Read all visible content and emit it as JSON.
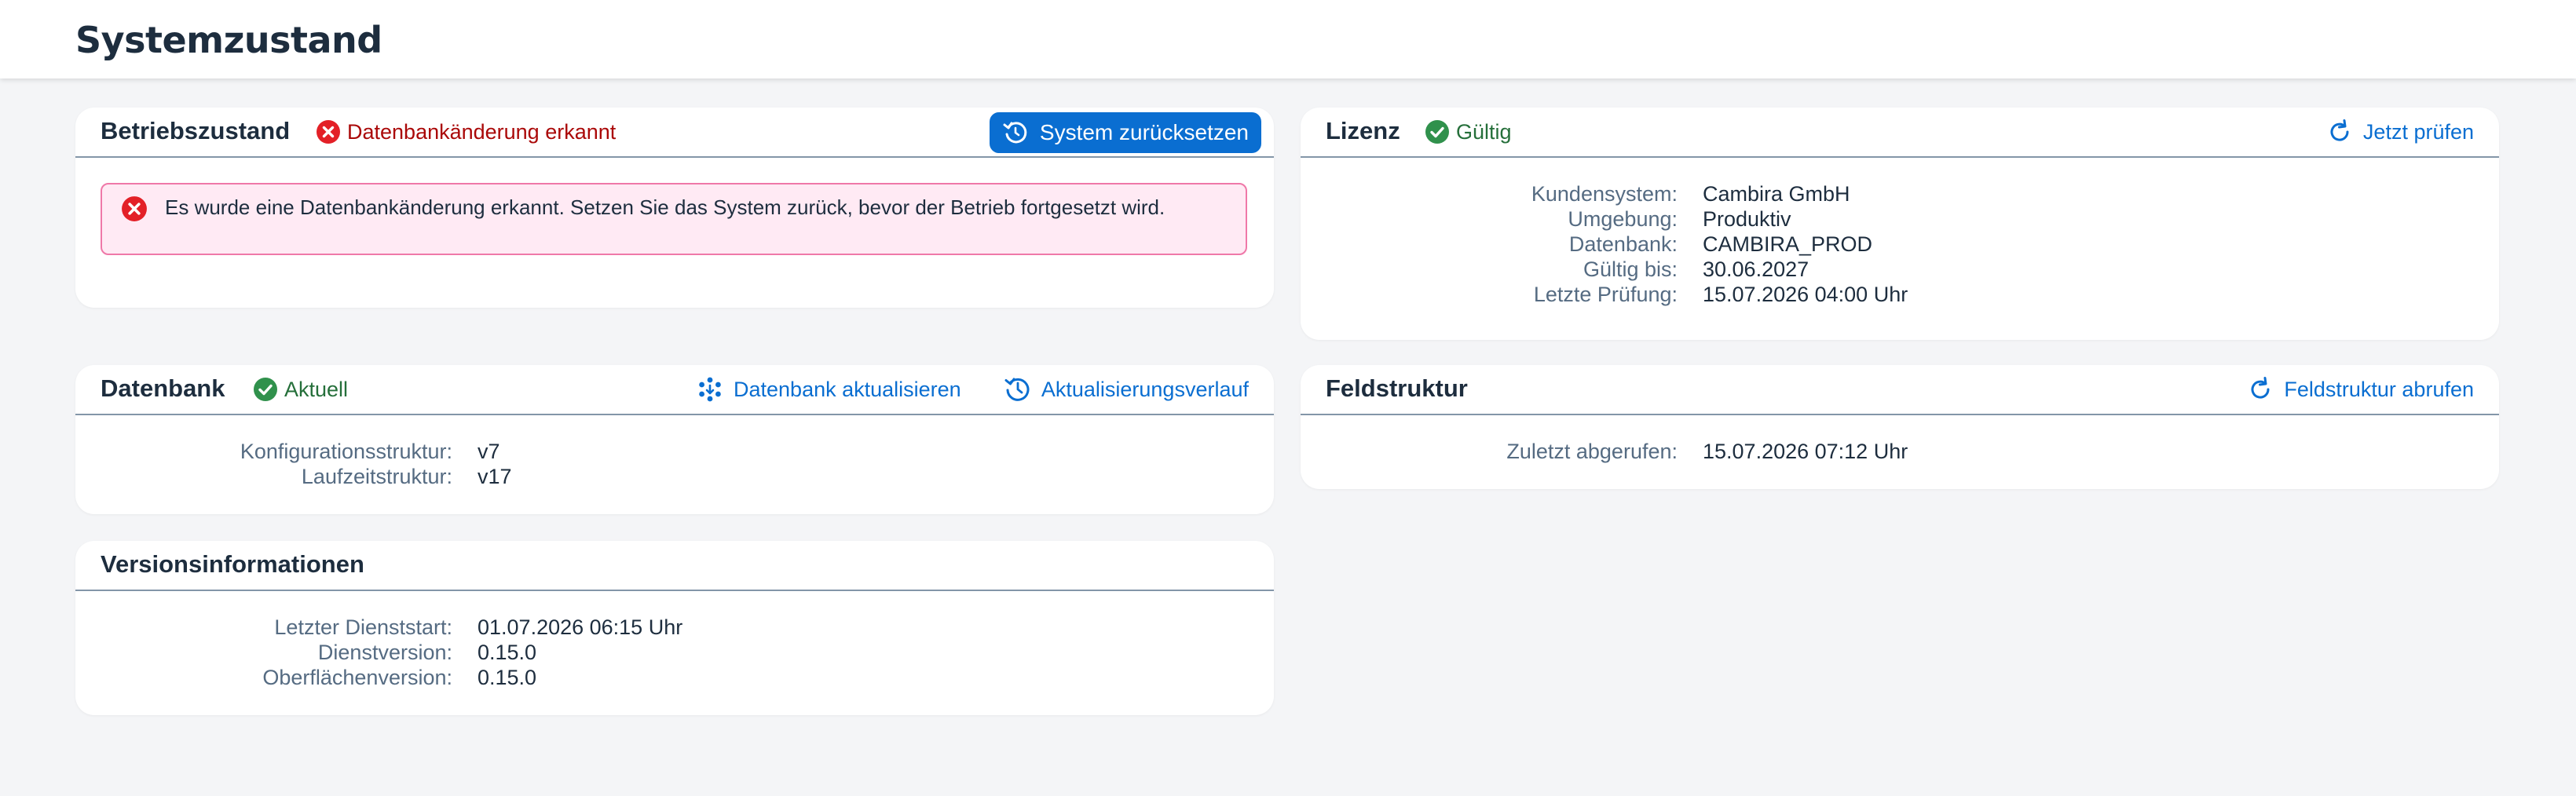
{
  "header": {
    "title": "Systemzustand"
  },
  "betriebszustand": {
    "title": "Betriebszustand",
    "status": "Datenbankänderung erkannt",
    "reset_button": "System zurücksetzen",
    "alert": "Es wurde eine Datenbankänderung erkannt. Setzen Sie das System zurück, bevor der Betrieb fortgesetzt wird."
  },
  "lizenz": {
    "title": "Lizenz",
    "status": "Gültig",
    "check_button": "Jetzt prüfen",
    "fields": [
      {
        "label": "Kundensystem:",
        "value": "Cambira GmbH"
      },
      {
        "label": "Umgebung:",
        "value": "Produktiv"
      },
      {
        "label": "Datenbank:",
        "value": "CAMBIRA_PROD"
      },
      {
        "label": "Gültig bis:",
        "value": "30.06.2027"
      },
      {
        "label": "Letzte Prüfung:",
        "value": "15.07.2026 04:00 Uhr"
      }
    ]
  },
  "datenbank": {
    "title": "Datenbank",
    "status": "Aktuell",
    "update_button": "Datenbank aktualisieren",
    "history_button": "Aktualisierungsverlauf",
    "fields": [
      {
        "label": "Konfigurationsstruktur:",
        "value": "v7"
      },
      {
        "label": "Laufzeitstruktur:",
        "value": "v17"
      }
    ]
  },
  "feldstruktur": {
    "title": "Feldstruktur",
    "fetch_button": "Feldstruktur abrufen",
    "fields": [
      {
        "label": "Zuletzt abgerufen:",
        "value": "15.07.2026 07:12 Uhr"
      }
    ]
  },
  "versionsinformationen": {
    "title": "Versionsinformationen",
    "fields": [
      {
        "label": "Letzter Dienststart:",
        "value": "01.07.2026 06:15 Uhr"
      },
      {
        "label": "Dienstversion:",
        "value": "0.15.0"
      },
      {
        "label": "Oberflächenversion:",
        "value": "0.15.0"
      }
    ]
  },
  "colors": {
    "accent": "#0a6ed1",
    "error": "#aa0808",
    "success": "#256f3a",
    "alert_bg": "#ffeaf4",
    "alert_border": "#ef78a8"
  },
  "icons": {
    "error": "error-circle-icon",
    "ok": "success-check-icon",
    "reset": "reset-icon",
    "refresh": "refresh-icon",
    "update": "database-update-icon",
    "history": "history-icon"
  }
}
